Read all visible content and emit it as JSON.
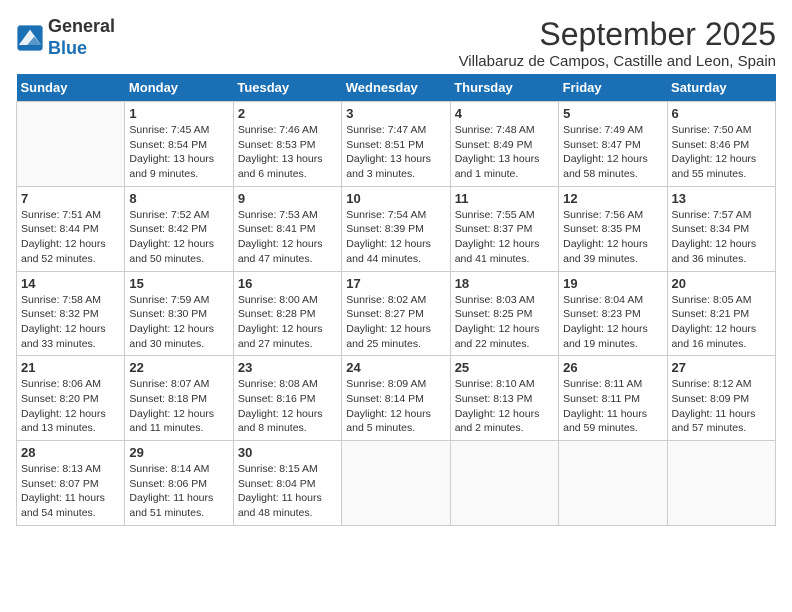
{
  "header": {
    "logo_line1": "General",
    "logo_line2": "Blue",
    "title": "September 2025",
    "subtitle": "Villabaruz de Campos, Castille and Leon, Spain"
  },
  "weekdays": [
    "Sunday",
    "Monday",
    "Tuesday",
    "Wednesday",
    "Thursday",
    "Friday",
    "Saturday"
  ],
  "weeks": [
    [
      {
        "day": "",
        "info": ""
      },
      {
        "day": "1",
        "info": "Sunrise: 7:45 AM\nSunset: 8:54 PM\nDaylight: 13 hours\nand 9 minutes."
      },
      {
        "day": "2",
        "info": "Sunrise: 7:46 AM\nSunset: 8:53 PM\nDaylight: 13 hours\nand 6 minutes."
      },
      {
        "day": "3",
        "info": "Sunrise: 7:47 AM\nSunset: 8:51 PM\nDaylight: 13 hours\nand 3 minutes."
      },
      {
        "day": "4",
        "info": "Sunrise: 7:48 AM\nSunset: 8:49 PM\nDaylight: 13 hours\nand 1 minute."
      },
      {
        "day": "5",
        "info": "Sunrise: 7:49 AM\nSunset: 8:47 PM\nDaylight: 12 hours\nand 58 minutes."
      },
      {
        "day": "6",
        "info": "Sunrise: 7:50 AM\nSunset: 8:46 PM\nDaylight: 12 hours\nand 55 minutes."
      }
    ],
    [
      {
        "day": "7",
        "info": "Sunrise: 7:51 AM\nSunset: 8:44 PM\nDaylight: 12 hours\nand 52 minutes."
      },
      {
        "day": "8",
        "info": "Sunrise: 7:52 AM\nSunset: 8:42 PM\nDaylight: 12 hours\nand 50 minutes."
      },
      {
        "day": "9",
        "info": "Sunrise: 7:53 AM\nSunset: 8:41 PM\nDaylight: 12 hours\nand 47 minutes."
      },
      {
        "day": "10",
        "info": "Sunrise: 7:54 AM\nSunset: 8:39 PM\nDaylight: 12 hours\nand 44 minutes."
      },
      {
        "day": "11",
        "info": "Sunrise: 7:55 AM\nSunset: 8:37 PM\nDaylight: 12 hours\nand 41 minutes."
      },
      {
        "day": "12",
        "info": "Sunrise: 7:56 AM\nSunset: 8:35 PM\nDaylight: 12 hours\nand 39 minutes."
      },
      {
        "day": "13",
        "info": "Sunrise: 7:57 AM\nSunset: 8:34 PM\nDaylight: 12 hours\nand 36 minutes."
      }
    ],
    [
      {
        "day": "14",
        "info": "Sunrise: 7:58 AM\nSunset: 8:32 PM\nDaylight: 12 hours\nand 33 minutes."
      },
      {
        "day": "15",
        "info": "Sunrise: 7:59 AM\nSunset: 8:30 PM\nDaylight: 12 hours\nand 30 minutes."
      },
      {
        "day": "16",
        "info": "Sunrise: 8:00 AM\nSunset: 8:28 PM\nDaylight: 12 hours\nand 27 minutes."
      },
      {
        "day": "17",
        "info": "Sunrise: 8:02 AM\nSunset: 8:27 PM\nDaylight: 12 hours\nand 25 minutes."
      },
      {
        "day": "18",
        "info": "Sunrise: 8:03 AM\nSunset: 8:25 PM\nDaylight: 12 hours\nand 22 minutes."
      },
      {
        "day": "19",
        "info": "Sunrise: 8:04 AM\nSunset: 8:23 PM\nDaylight: 12 hours\nand 19 minutes."
      },
      {
        "day": "20",
        "info": "Sunrise: 8:05 AM\nSunset: 8:21 PM\nDaylight: 12 hours\nand 16 minutes."
      }
    ],
    [
      {
        "day": "21",
        "info": "Sunrise: 8:06 AM\nSunset: 8:20 PM\nDaylight: 12 hours\nand 13 minutes."
      },
      {
        "day": "22",
        "info": "Sunrise: 8:07 AM\nSunset: 8:18 PM\nDaylight: 12 hours\nand 11 minutes."
      },
      {
        "day": "23",
        "info": "Sunrise: 8:08 AM\nSunset: 8:16 PM\nDaylight: 12 hours\nand 8 minutes."
      },
      {
        "day": "24",
        "info": "Sunrise: 8:09 AM\nSunset: 8:14 PM\nDaylight: 12 hours\nand 5 minutes."
      },
      {
        "day": "25",
        "info": "Sunrise: 8:10 AM\nSunset: 8:13 PM\nDaylight: 12 hours\nand 2 minutes."
      },
      {
        "day": "26",
        "info": "Sunrise: 8:11 AM\nSunset: 8:11 PM\nDaylight: 11 hours\nand 59 minutes."
      },
      {
        "day": "27",
        "info": "Sunrise: 8:12 AM\nSunset: 8:09 PM\nDaylight: 11 hours\nand 57 minutes."
      }
    ],
    [
      {
        "day": "28",
        "info": "Sunrise: 8:13 AM\nSunset: 8:07 PM\nDaylight: 11 hours\nand 54 minutes."
      },
      {
        "day": "29",
        "info": "Sunrise: 8:14 AM\nSunset: 8:06 PM\nDaylight: 11 hours\nand 51 minutes."
      },
      {
        "day": "30",
        "info": "Sunrise: 8:15 AM\nSunset: 8:04 PM\nDaylight: 11 hours\nand 48 minutes."
      },
      {
        "day": "",
        "info": ""
      },
      {
        "day": "",
        "info": ""
      },
      {
        "day": "",
        "info": ""
      },
      {
        "day": "",
        "info": ""
      }
    ]
  ]
}
